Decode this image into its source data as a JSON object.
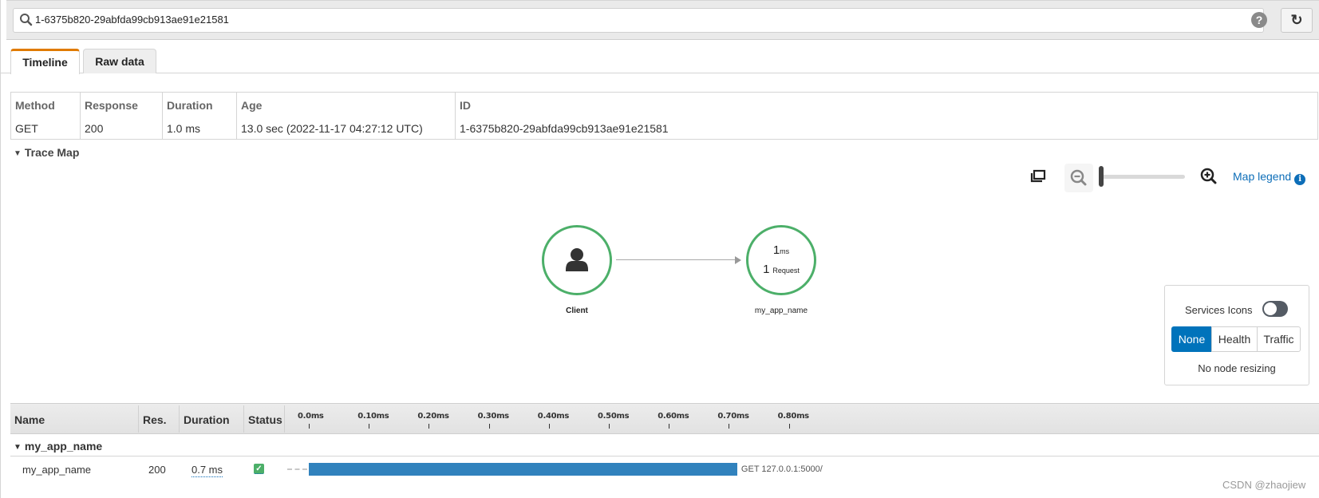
{
  "search": {
    "value": "1-6375b820-29abfda99cb913ae91e21581",
    "help_icon": "question-circle-icon",
    "refresh_icon": "refresh-icon"
  },
  "tabs": [
    {
      "label": "Timeline",
      "active": true
    },
    {
      "label": "Raw data",
      "active": false
    }
  ],
  "summary": {
    "columns": [
      {
        "header": "Method",
        "value": "GET"
      },
      {
        "header": "Response",
        "value": "200"
      },
      {
        "header": "Duration",
        "value": "1.0 ms"
      },
      {
        "header": "Age",
        "value": "13.0 sec (2022-11-17 04:27:12 UTC)"
      },
      {
        "header": "ID",
        "value": "1-6375b820-29abfda99cb913ae91e21581"
      }
    ]
  },
  "trace_map": {
    "section_label": "Trace Map",
    "toolbar": {
      "legend_label": "Map legend",
      "zoom_level": 0
    },
    "nodes": [
      {
        "name": "Client",
        "icon": "user-icon"
      },
      {
        "name": "my_app_name",
        "latency_value": "1",
        "latency_unit": "ms",
        "requests_value": "1",
        "requests_unit": "Request"
      }
    ],
    "services_panel": {
      "label": "Services Icons",
      "toggle_on": false,
      "options": [
        "None",
        "Health",
        "Traffic"
      ],
      "selected": "None",
      "note": "No node resizing"
    }
  },
  "timeline": {
    "headers": {
      "name": "Name",
      "res": "Res.",
      "duration": "Duration",
      "status": "Status"
    },
    "ticks": [
      "0.0ms",
      "0.10ms",
      "0.20ms",
      "0.30ms",
      "0.40ms",
      "0.50ms",
      "0.60ms",
      "0.70ms",
      "0.80ms"
    ],
    "groups": [
      {
        "name": "my_app_name",
        "rows": [
          {
            "name": "my_app_name",
            "response": "200",
            "duration": "0.7 ms",
            "status": "ok",
            "start_ms": 0.0,
            "end_ms": 0.714,
            "label": "GET 127.0.0.1:5000/"
          }
        ]
      }
    ]
  },
  "watermark": "CSDN @zhaojiew",
  "colors": {
    "accent_tab": "#e07b00",
    "node_ok": "#4caf69",
    "bar": "#3182bd",
    "selected_segment": "#0073bb",
    "link": "#0d6eb8"
  }
}
